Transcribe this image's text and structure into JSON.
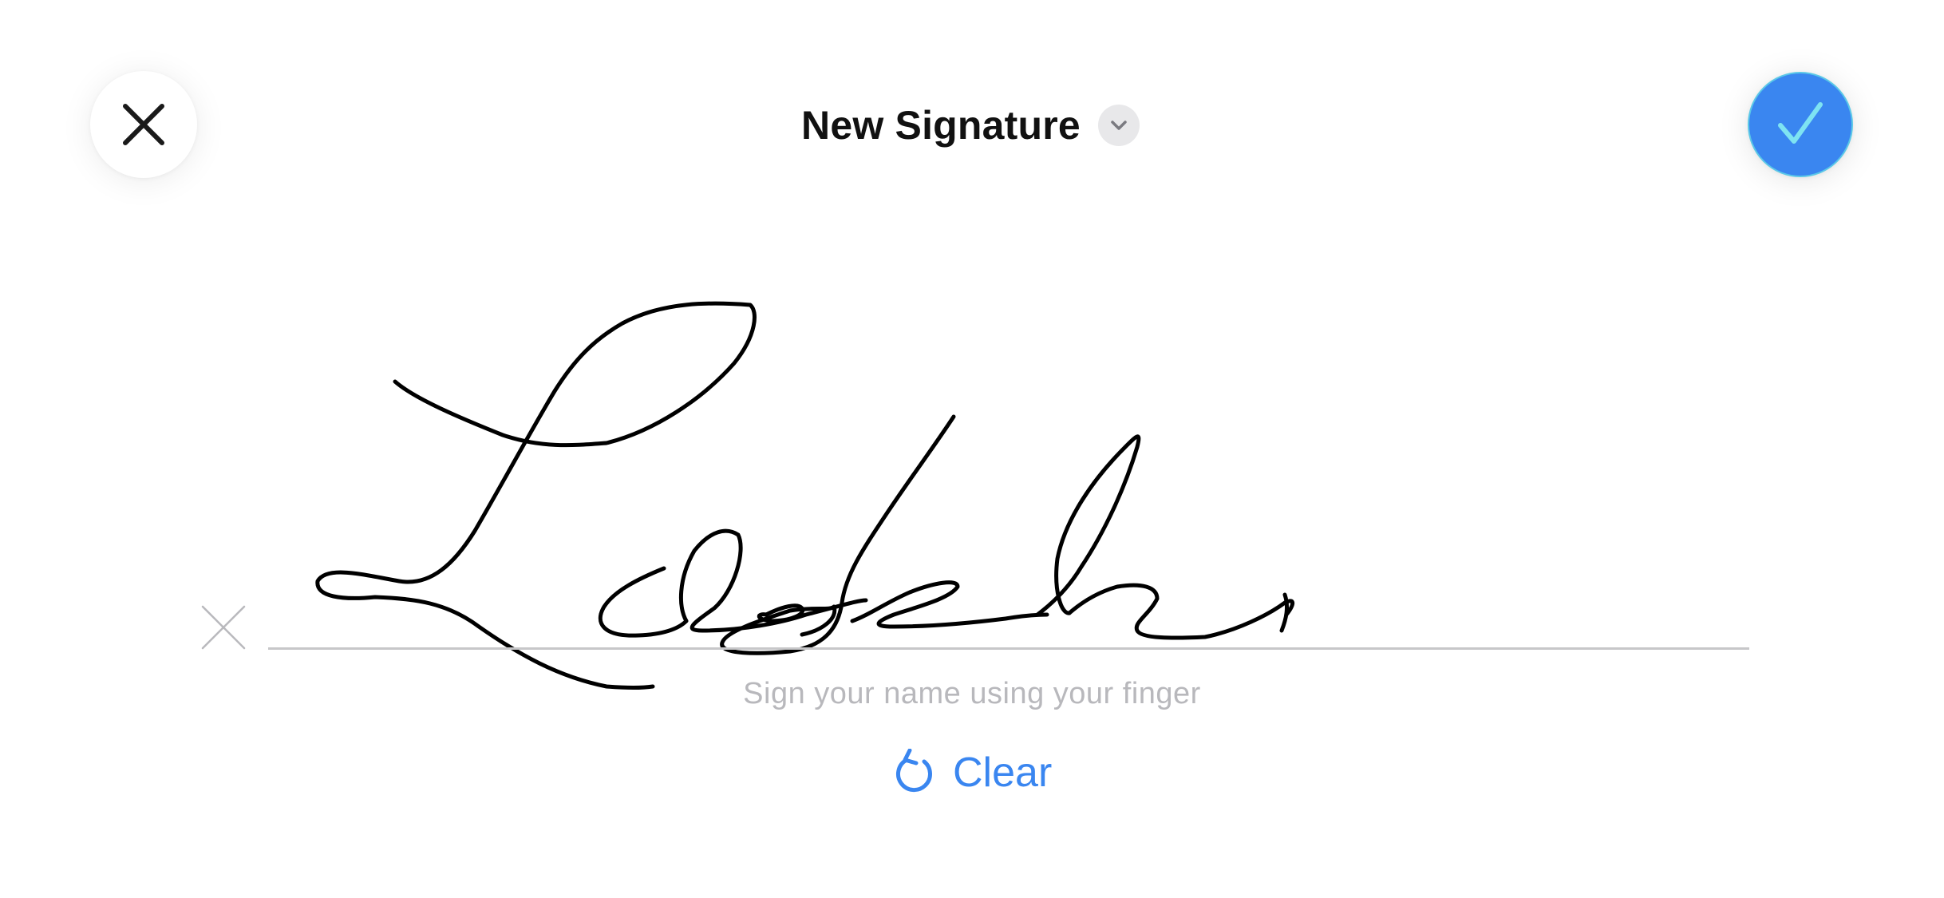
{
  "header": {
    "title": "New Signature",
    "close_icon": "close-icon",
    "done_icon": "checkmark-icon",
    "menu_icon": "chevron-down-icon"
  },
  "signature": {
    "hint": "Sign your name using your finger",
    "clear_label": "Clear",
    "clear_icon": "undo-arrow-icon",
    "sign_here_icon": "x-mark-icon"
  },
  "colors": {
    "accent": "#3a86f0",
    "done_border": "#5ac8e8",
    "hint_text": "#b8b8bc",
    "baseline": "#c7c7c9",
    "ink": "#000000"
  }
}
